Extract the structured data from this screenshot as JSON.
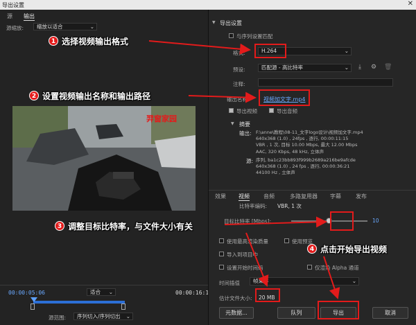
{
  "window": {
    "title": "导出设置",
    "close": "✕"
  },
  "left": {
    "tabs": [
      "源",
      "输出"
    ],
    "source_scale_label": "源缩放:",
    "source_scale_value": "缩放以适合",
    "watermark": "羿窗家园",
    "timecode_start": "00:00:05:06",
    "fit_value": "适合",
    "timecode_end": "00:00:16:15",
    "range_label": "源范围:",
    "range_value": "序列切入/序列切出"
  },
  "export": {
    "section_title": "导出设置",
    "match_seq_label": "与序列设置匹配",
    "format_label": "格式:",
    "format_value": "H.264",
    "preset_label": "预设:",
    "preset_value": "匹配源 - 高比特率",
    "notes_label": "注释:",
    "output_name_label": "输出名称:",
    "output_name_value": "视频加文字.mp4",
    "export_video_label": "导出视频",
    "export_audio_label": "导出音频",
    "summary_title": "摘要",
    "output_label": "输出:",
    "output_lines": [
      "F:\\anne\\教程\\08-11_文字logo设计\\视频加文字.mp4",
      "640x368 (1.0) , 24fps , 逐行, 00:00:11:15",
      "VBR , 1 次, 目标 10.00 Mbps, 最大 12.00 Mbps",
      "AAC, 320 Kbps, 48 kHz, 立体声"
    ],
    "source_label": "源:",
    "source_lines": [
      "序列, ba1c23bb893f999b2689a216be9afcde",
      "640x368 (1.0) , 24 fps , 逐行, 00:00:36:21",
      "44100 Hz , 立体声"
    ]
  },
  "bottom_tabs": [
    "效果",
    "视频",
    "音频",
    "多路复用器",
    "字幕",
    "发布"
  ],
  "video": {
    "bitrate_enc_label": "比特率编码:",
    "bitrate_enc_value": "VBR, 1 次",
    "target_bitrate_label": "目标比特率 [Mbps]:",
    "target_bitrate_value": "10",
    "target_bitrate_fraction": 0.5
  },
  "options": {
    "max_render": "使用最高渲染质量",
    "use_preview": "使用预览",
    "import_project": "导入到项目中",
    "start_timecode": "设置开始时间码",
    "render_alpha": "仅渲染 Alpha 通道",
    "interp_label": "时间插值",
    "interp_value": "帧采样",
    "filesize_label": "估计文件大小:",
    "filesize_value": "20 MB"
  },
  "buttons": {
    "metadata": "元数据...",
    "queue": "队列",
    "export": "导出",
    "cancel": "取消"
  },
  "annotations": {
    "c1": "选择视频输出格式",
    "c2": "设置视频输出名称和输出路径",
    "c3": "调整目标比特率，与文件大小有关",
    "c4": "点击开始导出视频",
    "n1": "1",
    "n2": "2",
    "n3": "3",
    "n4": "4"
  }
}
